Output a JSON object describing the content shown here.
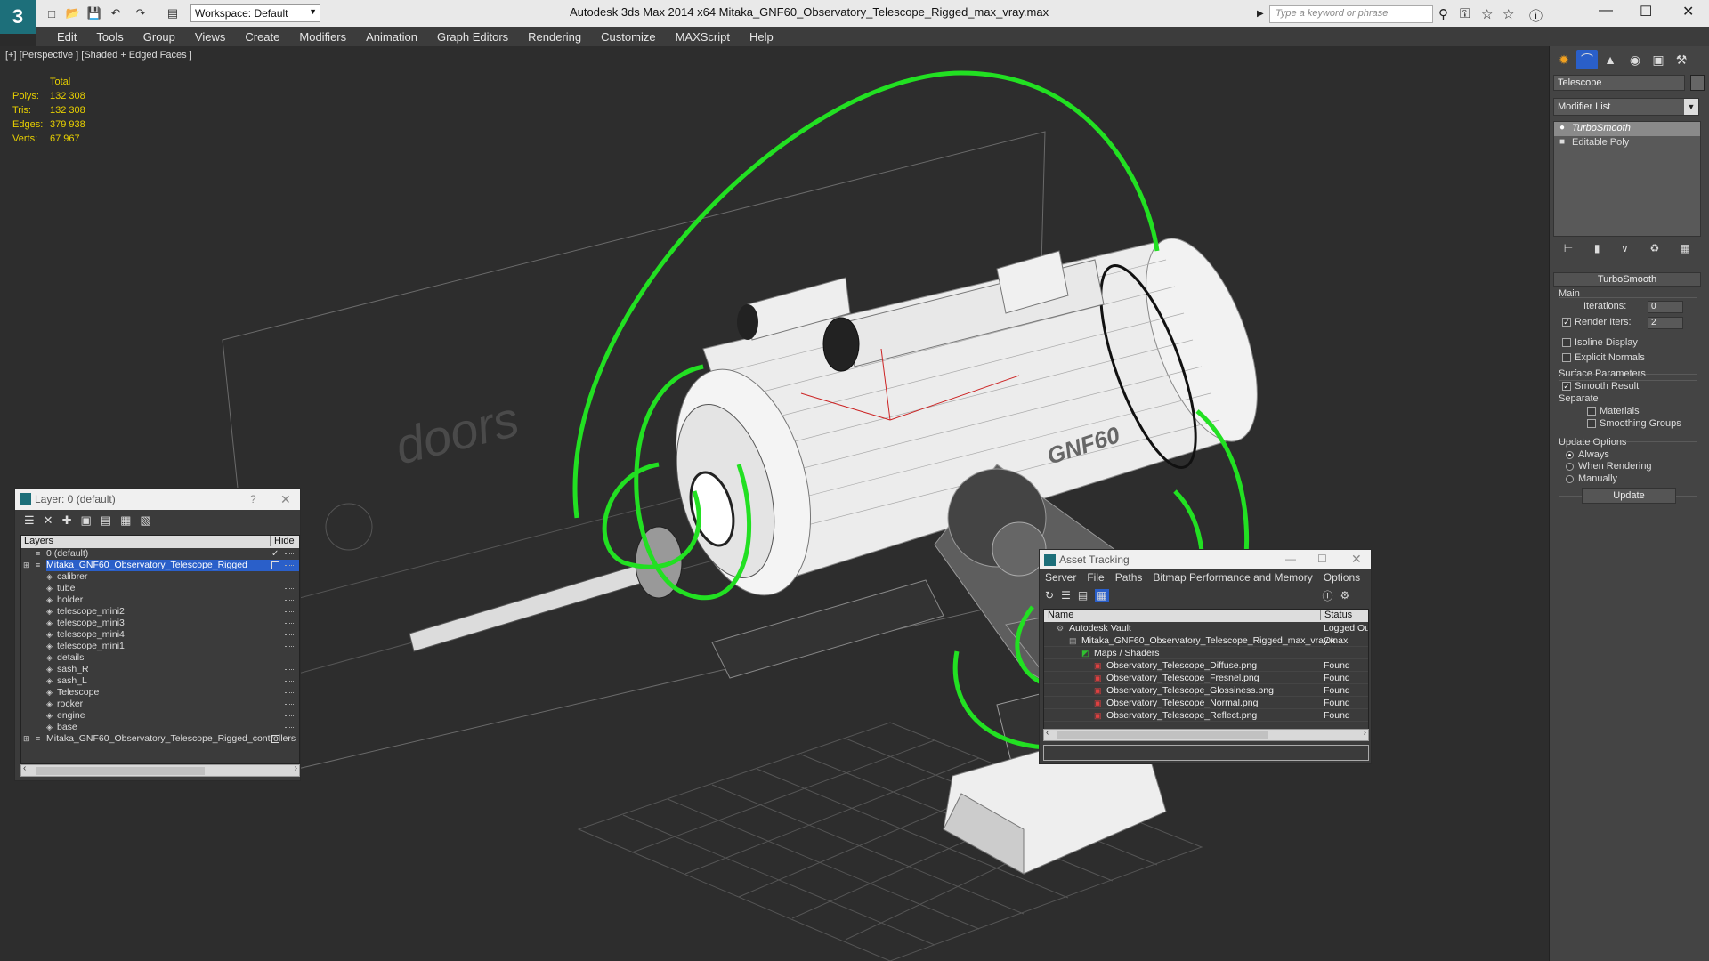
{
  "app": {
    "logo": "3",
    "title": "Autodesk 3ds Max  2014 x64      Mitaka_GNF60_Observatory_Telescope_Rigged_max_vray.max",
    "workspace": "Workspace: Default",
    "search_placeholder": "Type a keyword or phrase"
  },
  "menu": [
    "Edit",
    "Tools",
    "Group",
    "Views",
    "Create",
    "Modifiers",
    "Animation",
    "Graph Editors",
    "Rendering",
    "Customize",
    "MAXScript",
    "Help"
  ],
  "viewport": {
    "label": "[+] [Perspective ] [Shaded + Edged Faces ]",
    "stats_header": "Total",
    "stats": [
      {
        "k": "Polys:",
        "v": "132 308"
      },
      {
        "k": "Tris:",
        "v": "132 308"
      },
      {
        "k": "Edges:",
        "v": "379 938"
      },
      {
        "k": "Verts:",
        "v": "67 967"
      }
    ],
    "scene_text": "doors",
    "model_text": "GNF60",
    "accent_color": "#22e022"
  },
  "command_panel": {
    "object_name": "Telescope",
    "modifier_list": "Modifier List",
    "stack": [
      "TurboSmooth",
      "Editable Poly"
    ],
    "rollout": "TurboSmooth",
    "main_label": "Main",
    "iterations_label": "Iterations:",
    "iterations_value": "0",
    "render_iters_label": "Render Iters:",
    "render_iters_value": "2",
    "isoline": "Isoline Display",
    "explicit": "Explicit Normals",
    "surface_params": "Surface Parameters",
    "smooth_result": "Smooth Result",
    "separate": "Separate",
    "materials": "Materials",
    "smoothing_groups": "Smoothing Groups",
    "update_options": "Update Options",
    "always": "Always",
    "when_rendering": "When Rendering",
    "manually": "Manually",
    "update_btn": "Update"
  },
  "layer_dialog": {
    "title": "Layer: 0 (default)",
    "help": "?",
    "col_layers": "Layers",
    "col_hide": "Hide",
    "rows": [
      {
        "name": "0 (default)",
        "level": 0
      },
      {
        "name": "Mitaka_GNF60_Observatory_Telescope_Rigged",
        "level": 0,
        "selected": true
      },
      {
        "name": "calibrer",
        "level": 1
      },
      {
        "name": "tube",
        "level": 1
      },
      {
        "name": "holder",
        "level": 1
      },
      {
        "name": "telescope_mini2",
        "level": 1
      },
      {
        "name": "telescope_mini3",
        "level": 1
      },
      {
        "name": "telescope_mini4",
        "level": 1
      },
      {
        "name": "telescope_mini1",
        "level": 1
      },
      {
        "name": "details",
        "level": 1
      },
      {
        "name": "sash_R",
        "level": 1
      },
      {
        "name": "sash_L",
        "level": 1
      },
      {
        "name": "Telescope",
        "level": 1
      },
      {
        "name": "rocker",
        "level": 1
      },
      {
        "name": "engine",
        "level": 1
      },
      {
        "name": "base",
        "level": 1
      },
      {
        "name": "Mitaka_GNF60_Observatory_Telescope_Rigged_controllers",
        "level": 0
      }
    ]
  },
  "asset_dialog": {
    "title": "Asset Tracking",
    "menu": [
      "Server",
      "File",
      "Paths",
      "Bitmap Performance and Memory",
      "Options"
    ],
    "col_name": "Name",
    "col_status": "Status",
    "rows": [
      {
        "name": "Autodesk Vault",
        "status": "Logged Out",
        "level": 0
      },
      {
        "name": "Mitaka_GNF60_Observatory_Telescope_Rigged_max_vray.max",
        "status": "Ok",
        "level": 1
      },
      {
        "name": "Maps / Shaders",
        "status": "",
        "level": 2
      },
      {
        "name": "Observatory_Telescope_Diffuse.png",
        "status": "Found",
        "level": 3
      },
      {
        "name": "Observatory_Telescope_Fresnel.png",
        "status": "Found",
        "level": 3
      },
      {
        "name": "Observatory_Telescope_Glossiness.png",
        "status": "Found",
        "level": 3
      },
      {
        "name": "Observatory_Telescope_Normal.png",
        "status": "Found",
        "level": 3
      },
      {
        "name": "Observatory_Telescope_Reflect.png",
        "status": "Found",
        "level": 3
      }
    ]
  }
}
